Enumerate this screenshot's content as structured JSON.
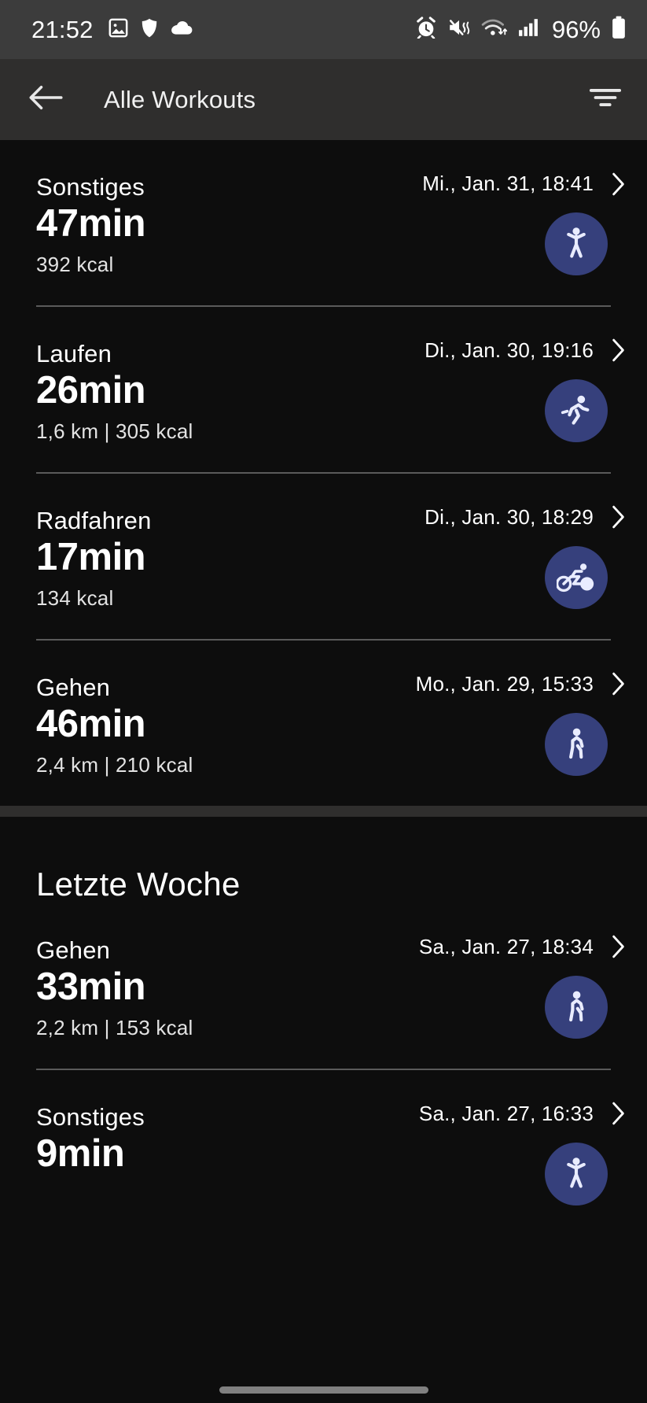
{
  "status_bar": {
    "time": "21:52",
    "battery_percent": "96%",
    "left_icons": [
      "image-icon",
      "shield-icon",
      "cloud-icon"
    ],
    "right_icons": [
      "alarm-icon",
      "mute-vibrate-icon",
      "wifi-icon",
      "signal-icon",
      "battery-icon"
    ]
  },
  "app_bar": {
    "back_icon": "back-arrow-icon",
    "title": "Alle Workouts",
    "filter_icon": "filter-icon"
  },
  "sections": [
    {
      "title": null,
      "items": [
        {
          "type": "Sonstiges",
          "duration": "47min",
          "subtitle": "392 kcal",
          "date": "Mi., Jan. 31, 18:41",
          "icon": "other-activity-icon"
        },
        {
          "type": "Laufen",
          "duration": "26min",
          "subtitle": "1,6 km | 305 kcal",
          "date": "Di., Jan. 30, 19:16",
          "icon": "running-icon"
        },
        {
          "type": "Radfahren",
          "duration": "17min",
          "subtitle": "134 kcal",
          "date": "Di., Jan. 30, 18:29",
          "icon": "cycling-icon"
        },
        {
          "type": "Gehen",
          "duration": "46min",
          "subtitle": "2,4 km | 210 kcal",
          "date": "Mo., Jan. 29, 15:33",
          "icon": "walking-icon"
        }
      ]
    },
    {
      "title": "Letzte Woche",
      "items": [
        {
          "type": "Gehen",
          "duration": "33min",
          "subtitle": "2,2 km | 153 kcal",
          "date": "Sa., Jan. 27, 18:34",
          "icon": "walking-icon"
        },
        {
          "type": "Sonstiges",
          "duration": "9min",
          "subtitle": "",
          "date": "Sa., Jan. 27, 16:33",
          "icon": "other-activity-icon"
        }
      ]
    }
  ],
  "colors": {
    "accent": "#36407c",
    "background": "#0d0d0d",
    "appbar": "#2f2e2d",
    "statusbar": "#3c3c3c"
  }
}
